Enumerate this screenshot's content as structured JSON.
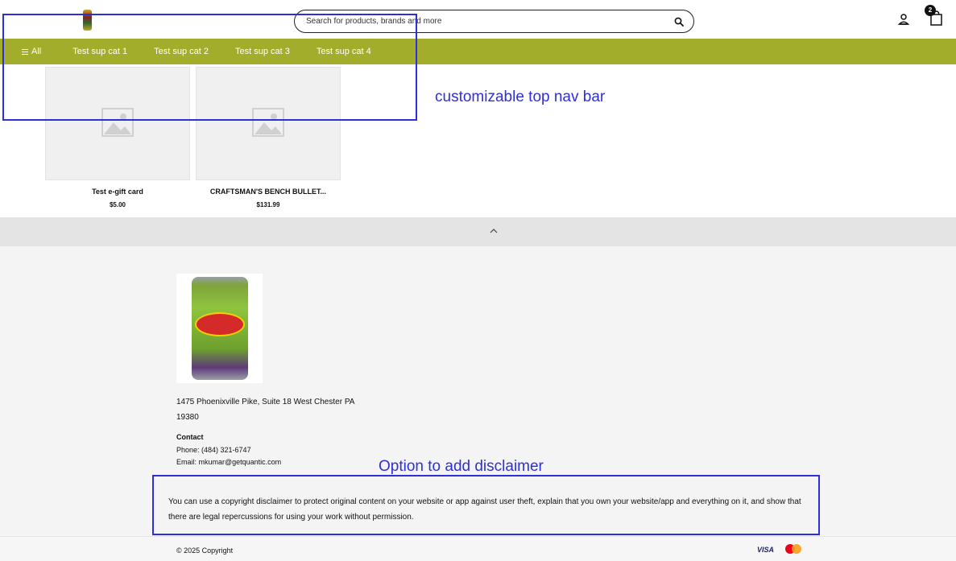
{
  "header": {
    "search_placeholder": "Search for products, brands and more",
    "cart_count": "2"
  },
  "nav": {
    "all_label": "All",
    "items": [
      "Test sup cat 1",
      "Test sup cat 2",
      "Test sup cat 3",
      "Test sup cat 4"
    ]
  },
  "products": [
    {
      "name": "Test e-gift card",
      "price": "$5.00"
    },
    {
      "name": "CRAFTSMAN'S BENCH BULLET...",
      "price": "$131.99"
    }
  ],
  "annotations": {
    "nav_note": "customizable top nav bar",
    "disclaimer_note": "Option to add disclaimer"
  },
  "footer": {
    "address_line1": "1475 Phoenixville Pike, Suite 18 West Chester PA",
    "address_line2": "19380",
    "contact_heading": "Contact",
    "phone": "Phone: (484) 321-6747",
    "email": "Email: mkumar@getquantic.com",
    "disclaimer": "You can use a copyright disclaimer to protect original content on your website or app against user theft, explain that you own your website/app and everything on it, and show that there are legal repercussions for using your work without permission.",
    "copyright": "© 2025 Copyright",
    "payment_visa": "VISA"
  },
  "colors": {
    "nav_bg": "#a2ae2b",
    "annotation": "#2f2fd8"
  }
}
